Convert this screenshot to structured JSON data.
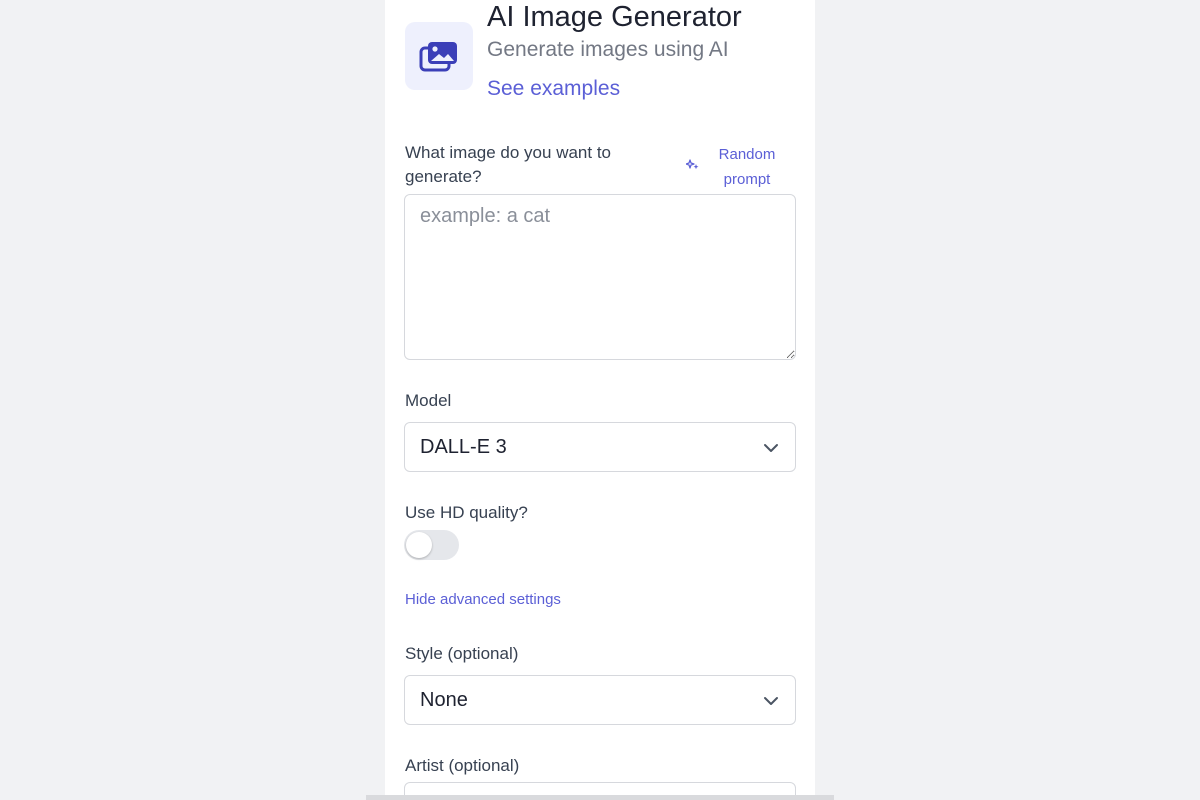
{
  "header": {
    "title": "AI Image Generator",
    "subtitle": "Generate images using AI",
    "examples_link": "See examples",
    "icon": "images-icon"
  },
  "prompt": {
    "label": "What image do you want to generate?",
    "random_label": "Random prompt",
    "placeholder": "example: a cat",
    "value": ""
  },
  "model": {
    "label": "Model",
    "selected": "DALL-E 3"
  },
  "hd": {
    "label": "Use HD quality?",
    "enabled": false
  },
  "advanced": {
    "toggle_label": "Hide advanced settings"
  },
  "style": {
    "label": "Style (optional)",
    "selected": "None"
  },
  "artist": {
    "label": "Artist (optional)"
  },
  "colors": {
    "accent": "#5b5fd6",
    "icon_bg": "#eef0fd",
    "page_bg": "#f1f2f4"
  }
}
